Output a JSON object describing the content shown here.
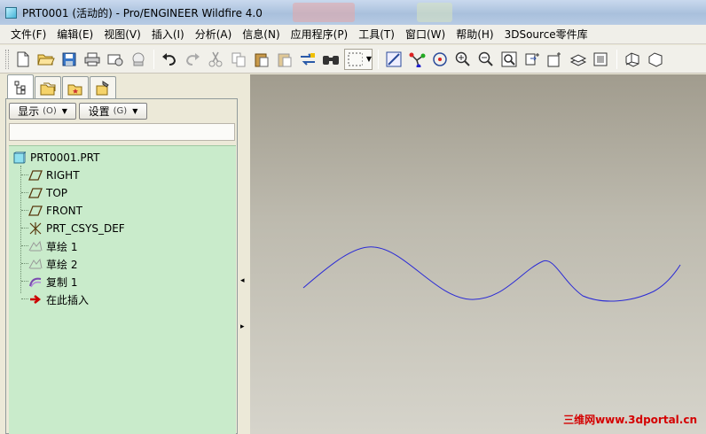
{
  "window": {
    "title": "PRT0001 (活动的) - Pro/ENGINEER Wildfire 4.0"
  },
  "menu": {
    "items": [
      "文件(F)",
      "编辑(E)",
      "视图(V)",
      "插入(I)",
      "分析(A)",
      "信息(N)",
      "应用程序(P)",
      "工具(T)",
      "窗口(W)",
      "帮助(H)",
      "3DSource零件库"
    ]
  },
  "toolbar": {
    "icons": [
      "new-icon",
      "open-icon",
      "save-icon",
      "print-icon",
      "send-mail-icon",
      "mail-attach-icon",
      "undo-icon",
      "redo-icon",
      "cut-icon",
      "copy-icon",
      "paste-icon",
      "paste-special-icon",
      "regenerate-icon",
      "find-icon",
      "selection-box-icon",
      "repaint-icon",
      "spin-center-icon",
      "orient-icon",
      "zoom-in-icon",
      "zoom-out-icon",
      "refit-icon",
      "reorient-icon",
      "saved-views-icon",
      "layers-icon",
      "view-manager-icon",
      "shading-icon"
    ]
  },
  "model_tree": {
    "tabs": [
      "model-tree-tab-icon",
      "folder-browser-tab-icon",
      "favorites-tab-icon",
      "connections-tab-icon"
    ],
    "show_label": "显示",
    "show_key": "(O)",
    "settings_label": "设置",
    "settings_key": "(G)",
    "root": "PRT0001.PRT",
    "items": [
      {
        "label": "RIGHT",
        "icon": "datum-plane-icon"
      },
      {
        "label": "TOP",
        "icon": "datum-plane-icon"
      },
      {
        "label": "FRONT",
        "icon": "datum-plane-icon"
      },
      {
        "label": "PRT_CSYS_DEF",
        "icon": "csys-icon"
      },
      {
        "label": "草绘 1",
        "icon": "sketch-icon"
      },
      {
        "label": "草绘 2",
        "icon": "sketch-icon"
      },
      {
        "label": "复制 1",
        "icon": "copy-feature-icon"
      },
      {
        "label": "在此插入",
        "icon": "insert-here-arrow-icon"
      }
    ]
  },
  "viewport": {
    "curve_color": "#2a2ad6",
    "watermark": "三维网www.3dportal.cn"
  }
}
